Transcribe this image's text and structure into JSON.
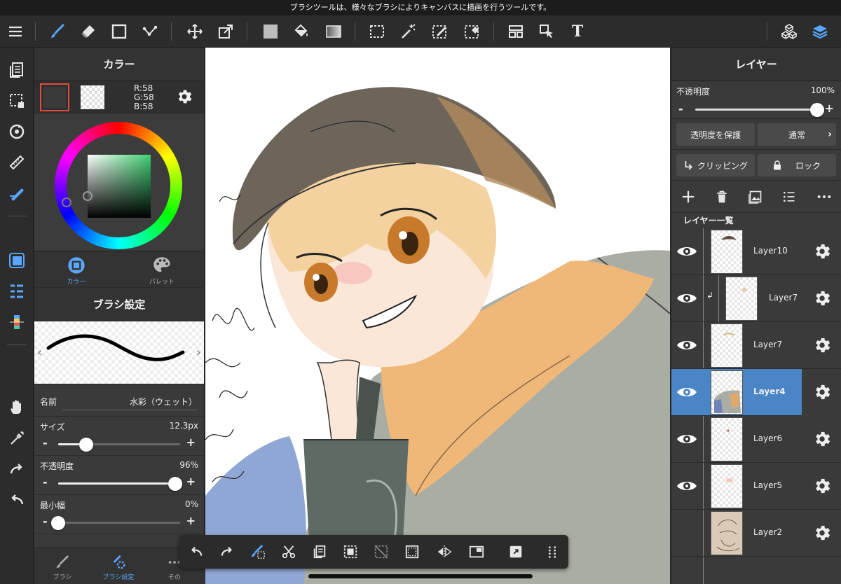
{
  "tooltip": "ブラシツールは、様々なブラシによりキャンバスに描画を行うツールです。",
  "toolbar": {
    "tools": [
      "menu-icon",
      "brush-icon",
      "eraser-icon",
      "rectangle-icon",
      "dot-line-icon",
      "move-icon",
      "transform-icon",
      "fill-color-icon",
      "bucket-icon",
      "gradient-icon",
      "select-rect-icon",
      "magic-wand-icon",
      "select-pen-icon",
      "select-eraser-icon",
      "frame-icon",
      "pointer-icon",
      "text-icon",
      "3d-material-icon",
      "layers-icon"
    ],
    "text_tool_glyph": "T"
  },
  "color_panel": {
    "title": "カラー",
    "r": "R:58",
    "g": "G:58",
    "b": "B:58",
    "main_color": "#3a3a3a",
    "tabs": {
      "color": "カラー",
      "palette": "パレット"
    }
  },
  "brush_panel": {
    "title": "ブラシ設定",
    "name_label": "名前",
    "name_value": "水彩（ウェット）",
    "size_label": "サイズ",
    "size_value": "12.3px",
    "size_fraction": 0.23,
    "opacity_label": "不透明度",
    "opacity_value": "96%",
    "opacity_fraction": 0.96,
    "minwidth_label": "最小幅",
    "minwidth_value": "0%",
    "minwidth_fraction": 0.0,
    "tabs": {
      "brush": "ブラシ",
      "brush_settings": "ブラシ設定",
      "other": "その"
    }
  },
  "layer_panel": {
    "title": "レイヤー",
    "opacity_label": "不透明度",
    "opacity_value": "100%",
    "opacity_fraction": 1.0,
    "protect_alpha": "透明度を保護",
    "blend_mode": "通常",
    "clipping": "クリッピング",
    "lock": "ロック",
    "list_title": "レイヤー一覧",
    "layers": [
      {
        "name": "Layer10",
        "visible": true,
        "selected": false,
        "clipped": false
      },
      {
        "name": "Layer7",
        "visible": true,
        "selected": false,
        "clipped": true
      },
      {
        "name": "Layer7",
        "visible": true,
        "selected": false,
        "clipped": false
      },
      {
        "name": "Layer4",
        "visible": true,
        "selected": true,
        "clipped": false
      },
      {
        "name": "Layer6",
        "visible": true,
        "selected": false,
        "clipped": false
      },
      {
        "name": "Layer5",
        "visible": true,
        "selected": false,
        "clipped": false
      },
      {
        "name": "Layer2",
        "visible": false,
        "selected": false,
        "clipped": false
      }
    ]
  },
  "colors": {
    "accent": "#5aa7ff",
    "selected_layer": "#4a86c5",
    "active_swatch_border": "#e24b3b"
  }
}
